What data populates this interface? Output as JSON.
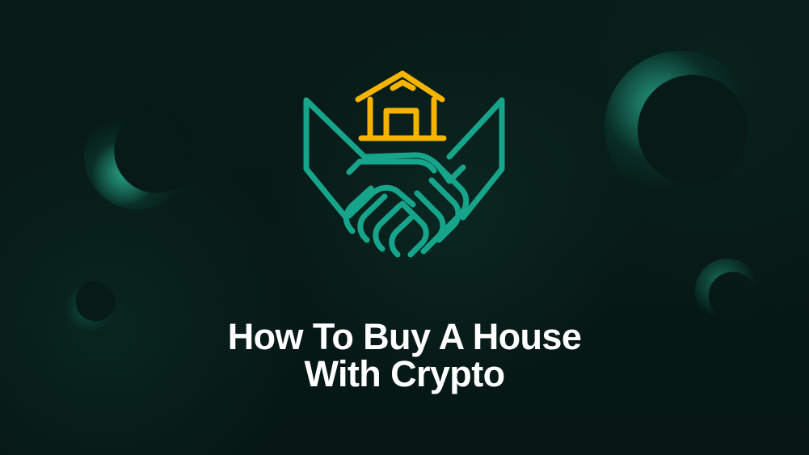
{
  "hero": {
    "title_line_1": "How To Buy A House",
    "title_line_2": "With Crypto"
  },
  "colors": {
    "background": "#071a17",
    "house": "#f4b400",
    "handshake": "#16a58b",
    "title": "#ffffff"
  },
  "icons": {
    "house": "house-icon",
    "handshake": "handshake-icon"
  }
}
